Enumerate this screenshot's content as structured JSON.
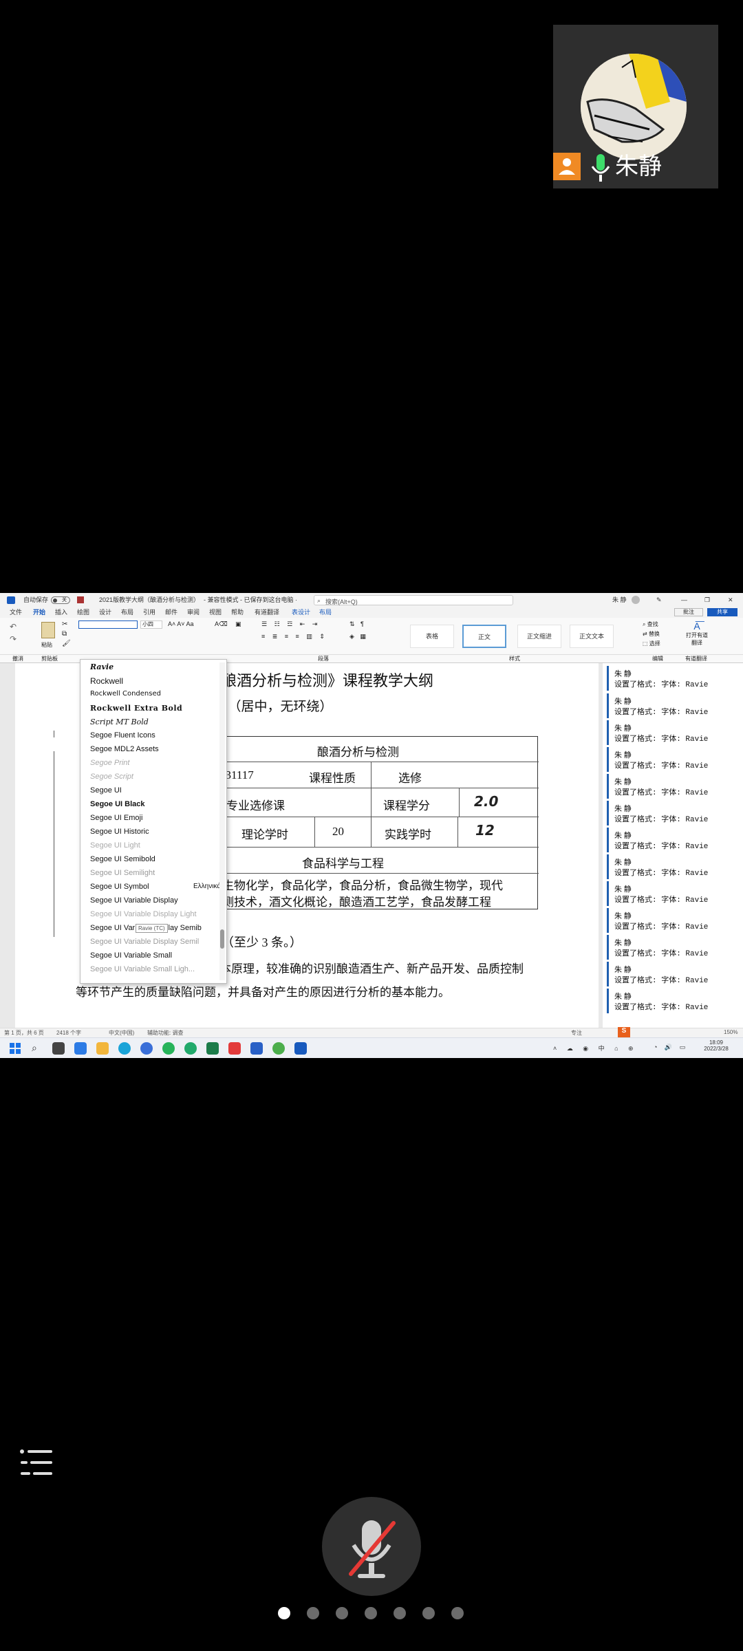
{
  "participant": {
    "name": "朱静"
  },
  "word": {
    "autosave_label": "自动保存",
    "autosave_state": "关",
    "doc_title": "2021版教学大纲（酿酒分析与检测）",
    "mode": "- 兼容性模式 - 已保存到这台电脑 ·",
    "search_placeholder": "搜索(Alt+Q)",
    "user": "朱 静",
    "menu": [
      "文件",
      "开始",
      "插入",
      "绘图",
      "设计",
      "布局",
      "引用",
      "邮件",
      "审阅",
      "视图",
      "帮助",
      "有道翻译",
      "表设计",
      "布局"
    ],
    "active_menu": "开始",
    "comments_btn": "批注",
    "share_btn": "共享",
    "font_size": "小四",
    "styles": [
      "表格",
      "正文",
      "正文缩进",
      "正文文本"
    ],
    "style_group_label": "样式",
    "paragraph_group_label": "段落",
    "clipboard_label": "剪贴板",
    "undo_label": "撤消",
    "paste_label": "粘贴",
    "find_label": "查找",
    "replace_label": "替换",
    "select_label": "选择",
    "edit_group_label": "编辑",
    "translate_label": "打开有道翻译",
    "translate_group_label": "有道翻译",
    "font_list": [
      "Ravie",
      "Rockwell",
      "Rockwell Condensed",
      "Rockwell Extra Bold",
      "Script MT Bold",
      "Segoe Fluent Icons",
      "Segoe MDL2 Assets",
      "Segoe Print",
      "Segoe Script",
      "Segoe UI",
      "Segoe UI Black",
      "Segoe UI Emoji",
      "Segoe UI Historic",
      "Segoe UI Light",
      "Segoe UI Semibold",
      "Segoe UI Semilight",
      "Segoe UI Symbol",
      "Segoe UI Variable Display",
      "Segoe UI Variable Display Light",
      "Segoe UI Variable Display Semib",
      "Segoe UI Variable Display Semil",
      "Segoe UI Variable Small",
      "Segoe UI Variable Small Ligh..."
    ],
    "font_symbol_sample": "Ελληνικά",
    "font_tooltip": "Ravie (TC)",
    "doc": {
      "heading": "酿酒分析与检测》课程教学大纲",
      "section1": "、（居中，无环绕）",
      "table_title": "酿酒分析与检测",
      "code": "631117",
      "course_nature_label": "课程性质",
      "course_nature": "选修",
      "course_type": "专业选修课",
      "credit_label": "课程学分",
      "credit": "2.0",
      "theory_hours_label": "理论学时",
      "theory_hours": "20",
      "practice_hours_label": "实践学时",
      "practice_hours": "12",
      "major": "食品科学与工程",
      "prereq_line1": "生物化学，食品化学，食品分析，食品微生物学，现代",
      "prereq_line2": "测技术，酒文化概论，酿造酒工艺学，食品发酵工程",
      "section2": "（至少 3 条。）",
      "objective1": "1. 能够应用本课程基本原理，较准确的识别酿造酒生产、新产品开发、品质控制",
      "objective1_cont": "等环节产生的质量缺陷问题，并具备对产生的原因进行分析的基本能力。"
    },
    "comment_author": "朱 静",
    "comment_text": "设置了格式: 字体: Ravie",
    "status": {
      "page": "第 1 页，共 6 页",
      "words": "2418 个字",
      "lang": "中文(中国)",
      "accessibility": "辅助功能: 调查",
      "focus": "专注",
      "zoom": "150%"
    },
    "clock": {
      "time": "18:09",
      "date": "2022/3/28"
    }
  }
}
